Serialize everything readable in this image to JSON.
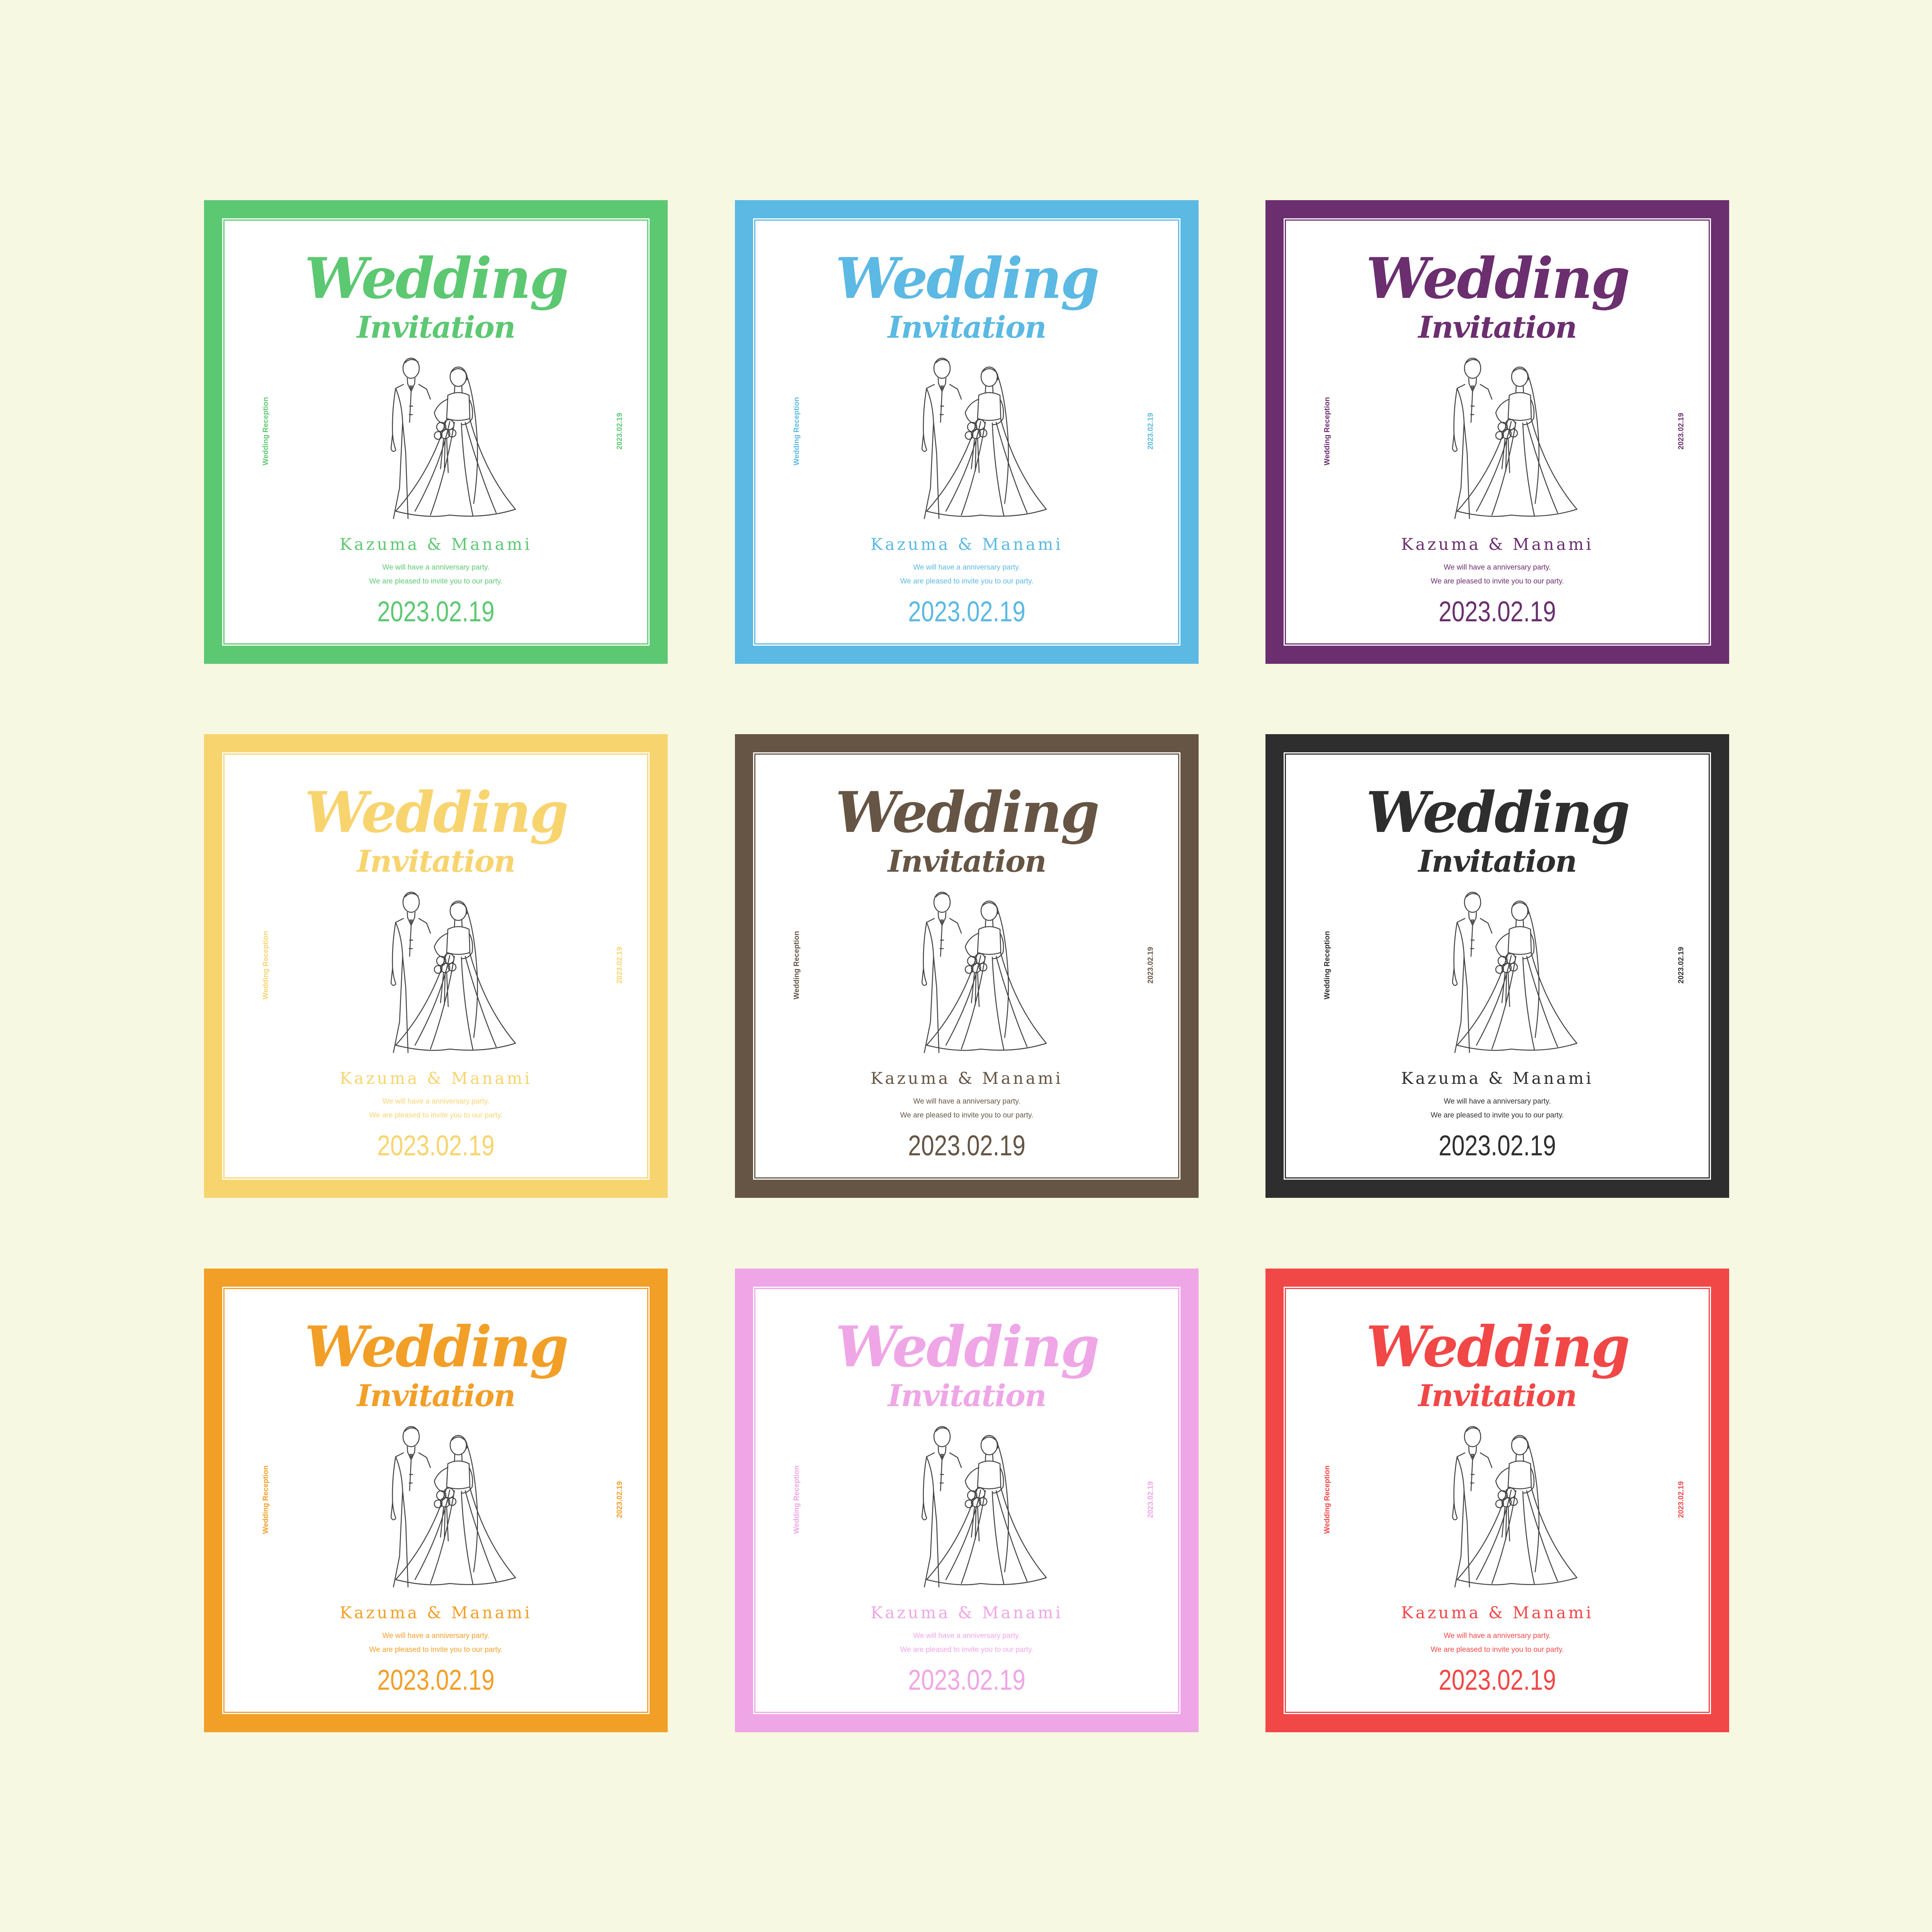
{
  "invitation": {
    "title": "Wedding",
    "subtitle": "Invitation",
    "side_left": "Wedding Reception",
    "side_right": "2023.02.19",
    "names": "Kazuma & Manami",
    "line1": "We will have a anniversary party.",
    "line2": "We are pleased to invite you to our party.",
    "date": "2023.02.19"
  },
  "cards": [
    {
      "accent": "#5dc872"
    },
    {
      "accent": "#5bb9e3"
    },
    {
      "accent": "#6b2e6f"
    },
    {
      "accent": "#f8d46f"
    },
    {
      "accent": "#665544"
    },
    {
      "accent": "#2e2e2e"
    },
    {
      "accent": "#f29f27"
    },
    {
      "accent": "#efa6e6"
    },
    {
      "accent": "#f24747"
    }
  ]
}
